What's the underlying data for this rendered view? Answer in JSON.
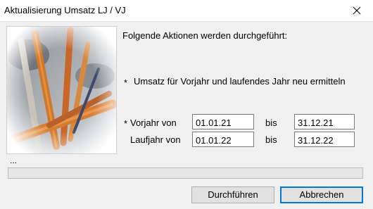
{
  "window": {
    "title": "Aktualisierung Umsatz LJ / VJ",
    "close_glyph": "✕"
  },
  "intro": "Folgende Aktionen werden durchgeführt:",
  "actions": [
    {
      "bullet": "*",
      "label": "Umsatz für Vorjahr und laufendes Jahr neu ermitteln"
    }
  ],
  "vorjahr": {
    "marker": "*",
    "label": "Vorjahr von",
    "from": "01.01.21",
    "bis_label": "bis",
    "to": "31.12.21"
  },
  "laufjahr": {
    "label": "Laufjahr von",
    "from": "01.01.22",
    "bis_label": "bis",
    "to": "31.12.22"
  },
  "status_text": "...",
  "progress": {
    "fraction": 0,
    "fill_color": "#06b025"
  },
  "buttons": {
    "execute": "Durchführen",
    "cancel": "Abbrechen"
  },
  "colors": {
    "accent": "#0078d7"
  }
}
